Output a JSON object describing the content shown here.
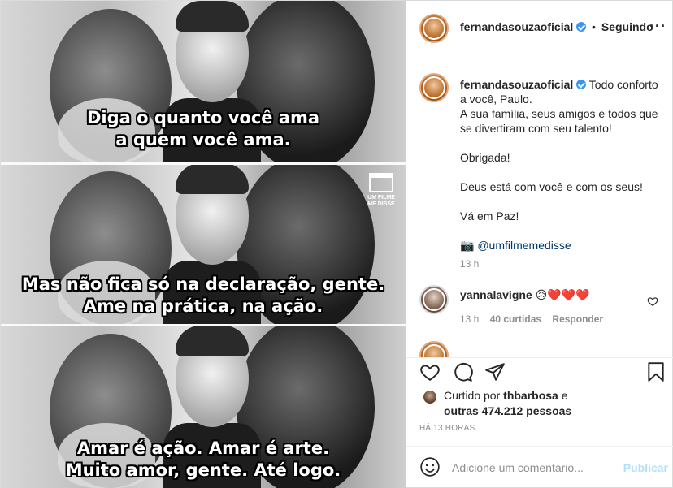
{
  "media": {
    "captions": [
      [
        "Diga o quanto você ama",
        "a quem você ama."
      ],
      [
        "Mas não fica só na declaração, gente.",
        "Ame na prática, na ação."
      ],
      [
        "Amar é ação. Amar é arte.",
        "Muito amor, gente. Até logo."
      ]
    ],
    "watermark": "UM FILME ME DISSE"
  },
  "header": {
    "username": "fernandasouzaoficial",
    "separator": "•",
    "follow_label": "Seguindo",
    "more_label": "···"
  },
  "caption": {
    "username": "fernandasouzaoficial",
    "first_line": "Todo conforto a você, Paulo.",
    "line2": "A sua família, seus amigos e todos que se divertiram com seu talento!",
    "line3": "Obrigada!",
    "line4": "Deus está com você e com os seus!",
    "line5": "Vá em Paz!",
    "mention_emoji": "📷",
    "mention": "@umfilmemedisse",
    "time": "13 h"
  },
  "comment": {
    "username": "yannalavigne",
    "text": "😥❤️❤️❤️",
    "time": "13 h",
    "likes": "40 curtidas",
    "reply": "Responder"
  },
  "likes": {
    "prefix": "Curtido por",
    "user": "thbarbosa",
    "middle": "e",
    "others": "outras 474.212 pessoas"
  },
  "posted_ago": "HÁ 13 HORAS",
  "add_comment": {
    "placeholder": "Adicione um comentário...",
    "post_label": "Publicar"
  }
}
